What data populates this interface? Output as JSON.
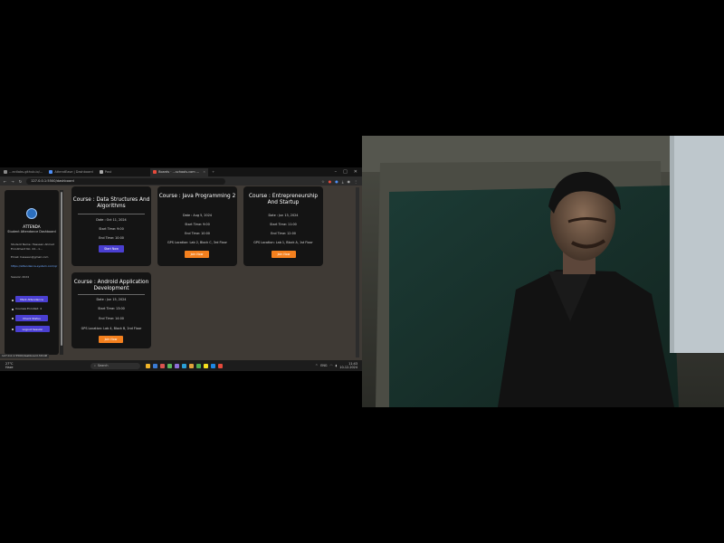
{
  "browser": {
    "tabs": [
      {
        "label": "…ectlabs.github.io/…",
        "active": false
      },
      {
        "label": "AttendEase | Dashboard",
        "active": false
      },
      {
        "label": "Post",
        "active": false
      },
      {
        "label": "Boards · …schools.com …",
        "active": true
      },
      {
        "label": "",
        "active": false
      }
    ],
    "new_tab_label": "+",
    "window_controls": [
      "–",
      "□",
      "✕"
    ],
    "nav": {
      "back": "←",
      "forward": "→",
      "reload": "↻"
    },
    "url": "127.0.0.1:5500/dashboard"
  },
  "sidebar": {
    "title": "ATTENDA",
    "subtitle": "Student Attendance Dashboard",
    "lines": [
      "Student Name: Hassaan Ahmed",
      "Enrollment No: 22…1…",
      "Email: hassaan@gmail.com",
      "https://attendance-system.com/qr",
      "Session 2024"
    ],
    "buttons": [
      {
        "label": "Mark Attendance"
      },
      {
        "label": "Check Status"
      },
      {
        "label": "Logout Session"
      }
    ],
    "plain_item": "Courses Enrolled: 4"
  },
  "cards": [
    {
      "title": "Course : Data Structures And Algorithms",
      "lines": [
        "Date : Oct 11, 2024",
        "Start Time: 9:00",
        "End Time: 10:00"
      ],
      "button": "Start Now",
      "button_color": "#4a3fd1"
    },
    {
      "title": "Course : Java Programming 2",
      "lines": [
        "Date : Aug 5, 2024",
        "Start Time: 9:00",
        "End Time: 10:00",
        "GPS Location: Lab 2, Block C, 3rd Floor"
      ],
      "button": "Join Now",
      "button_color": "#f4801e"
    },
    {
      "title": "Course : Entrepreneurship And Startup",
      "lines": [
        "Date : Jun 13, 2024",
        "Start Time: 11:00",
        "End Time: 12:00",
        "GPS Location: Lab 1, Block A, 1st Floor"
      ],
      "button": "Join Now",
      "button_color": "#f4801e"
    },
    {
      "title": "Course : Android Application Development",
      "lines": [
        "Date : Jun 15, 2024",
        "Start Time: 13:00",
        "End Time: 14:00",
        "GPS Location: Lab 4, Block B, 2nd Floor"
      ],
      "button": "Join Now",
      "button_color": "#f4801e"
    }
  ],
  "statusbar": "127.0.0.1:5500/dashboard.html#",
  "taskbar": {
    "weather_temp": "27°C",
    "weather_desc": "Haze",
    "search_placeholder": "Search",
    "time": "11:43",
    "date": "10-12-2024",
    "lang": "ENG"
  },
  "colors": {
    "accent_purple": "#4a3fd1",
    "accent_orange": "#f4801e",
    "card_bg": "#141414",
    "page_bg": "#3f3a35"
  }
}
